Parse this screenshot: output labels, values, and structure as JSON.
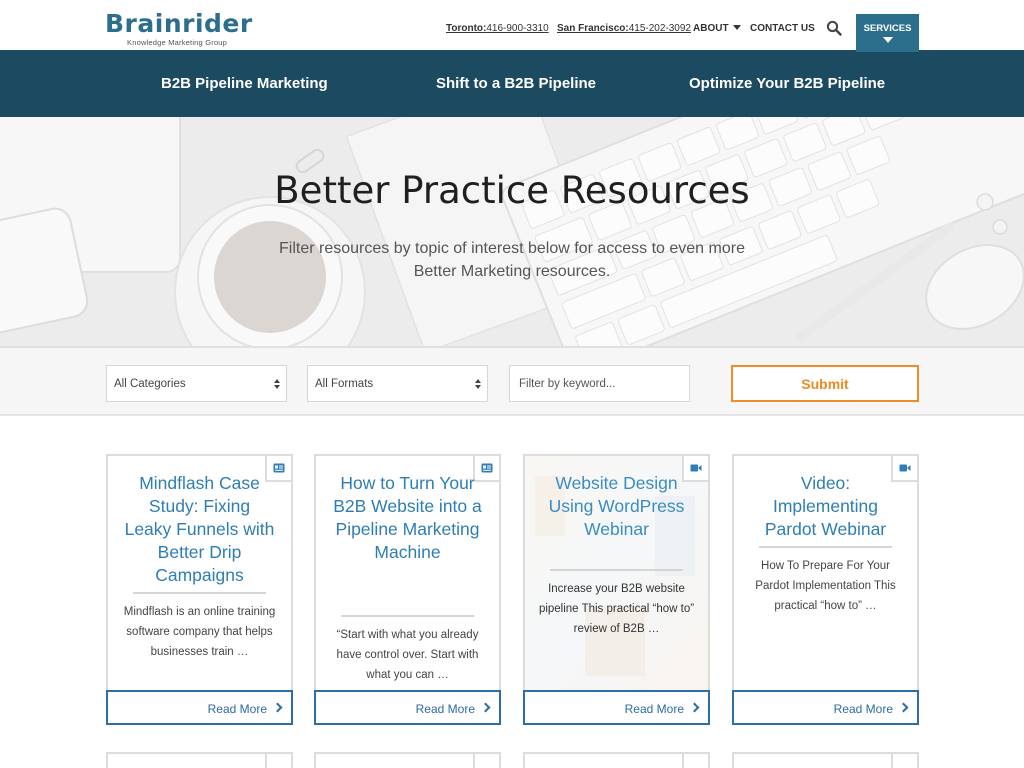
{
  "brand": {
    "name": "Brainrider",
    "tagline": "Knowledge Marketing Group",
    "primary_color": "#2c6f8c",
    "navy": "#1c4a61",
    "accent_orange": "#f08c2a",
    "link_blue": "#2e7eb5"
  },
  "header": {
    "contacts": [
      {
        "city": "Toronto:",
        "phone": "416-900-3310"
      },
      {
        "city": "San Francisco:",
        "phone": "415-202-3092"
      }
    ],
    "about_label": "ABOUT",
    "contact_label": "CONTACT US",
    "search_icon": "search-icon",
    "services_label": "SERVICES"
  },
  "subnav": {
    "items": [
      {
        "label": "B2B Pipeline Marketing"
      },
      {
        "label": "Shift to a B2B Pipeline"
      },
      {
        "label": "Optimize Your B2B Pipeline"
      }
    ]
  },
  "hero": {
    "title": "Better Practice Resources",
    "subtitle": "Filter resources by topic of interest below for access to even more Better Marketing resources."
  },
  "filters": {
    "category_selected": "All Categories",
    "format_selected": "All Formats",
    "keyword_placeholder": "Filter by keyword...",
    "keyword_value": "",
    "submit_label": "Submit"
  },
  "cards": [
    {
      "icon": "case-study-icon",
      "title": "Mindflash Case Study: Fixing Leaky Funnels with Better Drip Campaigns",
      "excerpt": "Mindflash is an online training software company that helps businesses train …",
      "read_more": "Read More"
    },
    {
      "icon": "article-icon",
      "title": "How to Turn Your B2B Website into a Pipeline Marketing Machine",
      "excerpt": "“Start with what you already have control over. Start with what you can …",
      "read_more": "Read More"
    },
    {
      "icon": "video-icon",
      "title": "Website Design Using WordPress Webinar",
      "excerpt": "Increase your B2B website pipeline This practical “how to” review of B2B …",
      "read_more": "Read More"
    },
    {
      "icon": "video-icon",
      "title": "Video: Implementing Pardot Webinar",
      "excerpt": "How To Prepare For Your Pardot Implementation This practical “how to” …",
      "read_more": "Read More"
    }
  ]
}
